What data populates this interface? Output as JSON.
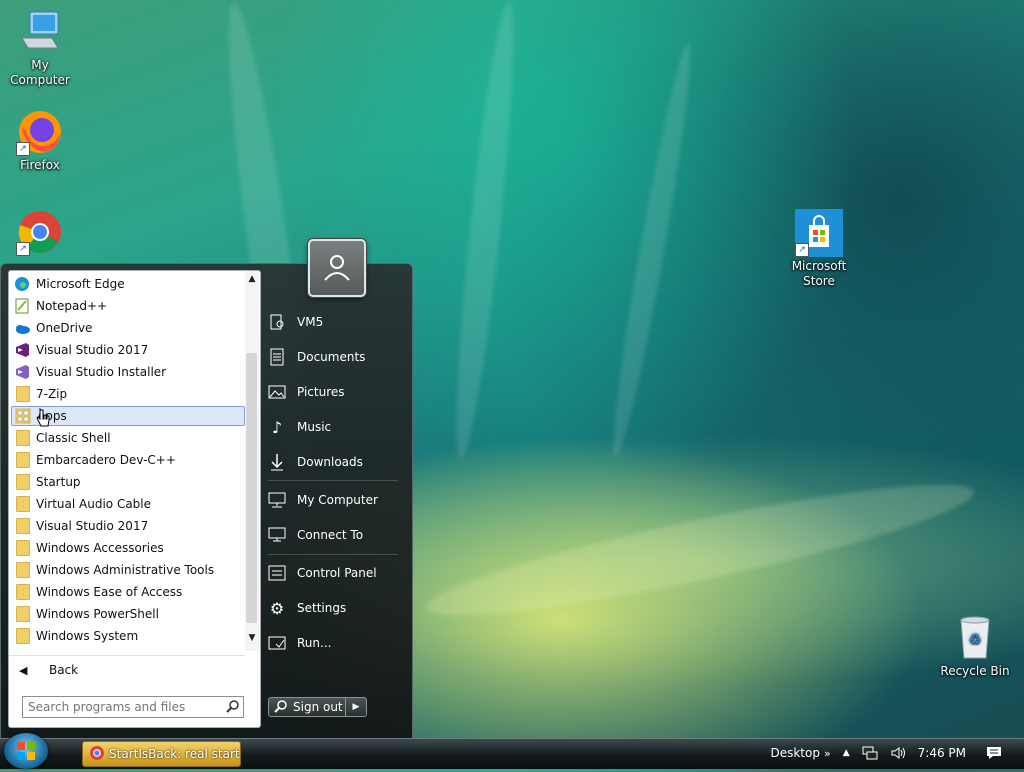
{
  "desktop": {
    "icons": {
      "my_computer": "My Computer",
      "firefox": "Firefox",
      "microsoft_store_line1": "Microsoft",
      "microsoft_store_line2": "Store",
      "recycle_bin": "Recycle Bin"
    }
  },
  "start_menu": {
    "programs": [
      {
        "label": "Microsoft Edge",
        "icon": "edge-icon"
      },
      {
        "label": "Notepad++",
        "icon": "notepadpp-icon"
      },
      {
        "label": "OneDrive",
        "icon": "onedrive-icon"
      },
      {
        "label": "Visual Studio 2017",
        "icon": "visual-studio-icon"
      },
      {
        "label": "Visual Studio Installer",
        "icon": "visual-studio-installer-icon"
      },
      {
        "label": "7-Zip",
        "icon": "folder-icon"
      },
      {
        "label": "Apps",
        "icon": "apps-grid-icon",
        "selected": true
      },
      {
        "label": "Classic Shell",
        "icon": "folder-icon"
      },
      {
        "label": "Embarcadero Dev-C++",
        "icon": "folder-icon"
      },
      {
        "label": "Startup",
        "icon": "folder-icon"
      },
      {
        "label": "Virtual Audio Cable",
        "icon": "folder-icon"
      },
      {
        "label": "Visual Studio 2017",
        "icon": "folder-icon"
      },
      {
        "label": "Windows Accessories",
        "icon": "folder-icon"
      },
      {
        "label": "Windows Administrative Tools",
        "icon": "folder-icon"
      },
      {
        "label": "Windows Ease of Access",
        "icon": "folder-icon"
      },
      {
        "label": "Windows PowerShell",
        "icon": "folder-icon"
      },
      {
        "label": "Windows System",
        "icon": "folder-icon"
      }
    ],
    "back_label": "Back",
    "search_placeholder": "Search programs and files",
    "right": {
      "user": "VM5",
      "documents": "Documents",
      "pictures": "Pictures",
      "music": "Music",
      "downloads": "Downloads",
      "my_computer": "My Computer",
      "connect_to": "Connect To",
      "control_panel": "Control Panel",
      "settings": "Settings",
      "run": "Run..."
    },
    "sign_out": "Sign out"
  },
  "taskbar": {
    "active_window": "StartIsBack: real start ...",
    "desktop_label": "Desktop",
    "overflow_label": "»",
    "clock": "7:46 PM"
  }
}
